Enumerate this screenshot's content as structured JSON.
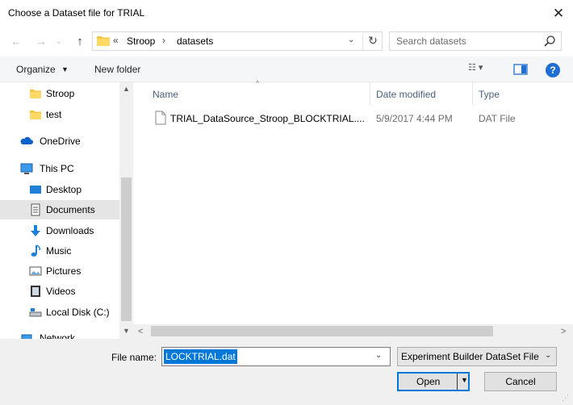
{
  "window": {
    "title": "Choose a Dataset file for TRIAL",
    "close_glyph": "✕"
  },
  "address": {
    "back_glyph": "←",
    "forward_glyph": "→",
    "recent_glyph": "⌄",
    "up_glyph": "↑",
    "chevron": "«",
    "segments": [
      "Stroop",
      "datasets"
    ],
    "separator": "›",
    "dropdown_glyph": "⌄",
    "refresh_glyph": "↻"
  },
  "search": {
    "placeholder": "Search datasets"
  },
  "toolbar": {
    "organize_label": "Organize",
    "organize_arrow": "▼",
    "new_folder_label": "New folder",
    "view_glyph": "☷ ▾",
    "help_glyph": "?"
  },
  "nav": {
    "items": [
      {
        "label": "Stroop",
        "icon": "folder-icon"
      },
      {
        "label": "test",
        "icon": "folder-icon"
      },
      {
        "label": "OneDrive",
        "icon": "cloud-icon"
      },
      {
        "label": "This PC",
        "icon": "computer-icon"
      },
      {
        "label": "Desktop",
        "icon": "desktop-icon"
      },
      {
        "label": "Documents",
        "icon": "documents-icon",
        "selected": true
      },
      {
        "label": "Downloads",
        "icon": "download-icon"
      },
      {
        "label": "Music",
        "icon": "music-icon"
      },
      {
        "label": "Pictures",
        "icon": "pictures-icon"
      },
      {
        "label": "Videos",
        "icon": "videos-icon"
      },
      {
        "label": "Local Disk (C:)",
        "icon": "disk-icon"
      },
      {
        "label": "Network",
        "icon": "network-icon"
      }
    ],
    "scroll_up": "▲",
    "scroll_down": "▼"
  },
  "columns": [
    "Name",
    "Date modified",
    "Type"
  ],
  "sort_arrow": "^",
  "files": [
    {
      "name": "TRIAL_DataSource_Stroop_BLOCKTRIAL....",
      "date": "5/9/2017 4:44 PM",
      "type": "DAT File"
    }
  ],
  "hscroll": {
    "left": "<",
    "right": ">"
  },
  "bottom": {
    "file_name_label": "File name:",
    "file_name_value": "LOCKTRIAL.dat",
    "file_name_drop": "⌄",
    "file_type": "Experiment Builder DataSet File",
    "file_type_drop": "⌄",
    "open_label": "Open",
    "open_arrow": "▼",
    "cancel_label": "Cancel",
    "grip": "⋰"
  },
  "colors": {
    "accent": "#0078d7",
    "header_text": "#4c607a",
    "selected_nav": "#e5e5e5",
    "folder": "#f6c644"
  }
}
